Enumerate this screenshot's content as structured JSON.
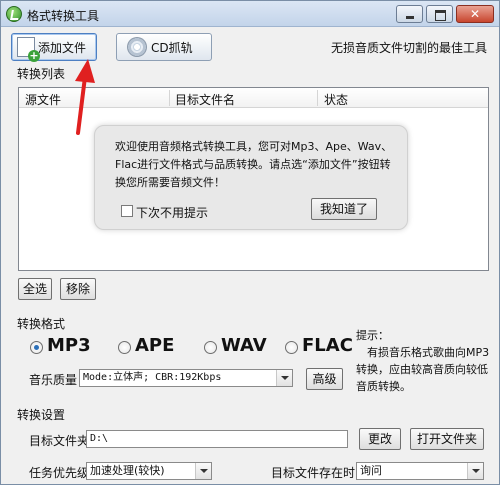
{
  "window": {
    "title": "格式转换工具"
  },
  "toolbar": {
    "add_file_label": "添加文件",
    "cd_rip_label": "CD抓轨",
    "slogan": "无损音质文件切割的最佳工具"
  },
  "list_section": {
    "title": "转换列表",
    "columns": [
      "源文件",
      "目标文件名",
      "状态"
    ]
  },
  "popup": {
    "message": "欢迎使用音频格式转换工具，您可对Mp3、Ape、Wav、Flac进行文件格式与品质转换。请点选“添加文件”按钮转换您所需要音频文件！",
    "checkbox_label": "下次不用提示",
    "button_label": "我知道了"
  },
  "list_buttons": {
    "select_all": "全选",
    "remove": "移除"
  },
  "format_section": {
    "title": "转换格式",
    "options": [
      "MP3",
      "APE",
      "WAV",
      "FLAC"
    ],
    "selected": "MP3",
    "quality_label": "音乐质量",
    "quality_value": "Mode:立体声; CBR:192Kbps",
    "advanced_label": "高级",
    "hint": "提示：\n　有损音乐格式歌曲向MP3转换，应由较高音质向较低音质转换。"
  },
  "settings_section": {
    "title": "转换设置",
    "target_folder_label": "目标文件夹",
    "target_folder_value": "D:\\",
    "change_label": "更改",
    "open_folder_label": "打开文件夹",
    "priority_label": "任务优先级",
    "priority_value": "加速处理(较快)",
    "exists_label": "目标文件存在时",
    "exists_value": "询问"
  },
  "colors": {
    "annotation_arrow": "#e02020",
    "accent": "#2b6fb8"
  }
}
